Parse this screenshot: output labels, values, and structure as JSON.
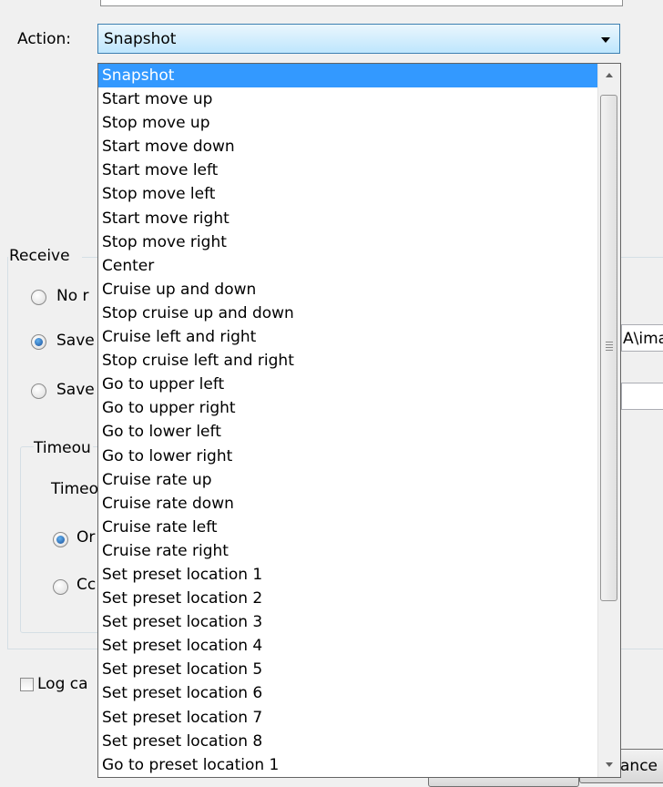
{
  "action": {
    "label": "Action:",
    "selected": "Snapshot"
  },
  "receive": {
    "label": "Receive",
    "options": [
      "No r",
      "Save",
      "Save"
    ],
    "path_fragment": "A\\ima"
  },
  "timeout": {
    "group_label": "Timeou",
    "field_label": "Timeo",
    "options": [
      "Or",
      "Cc"
    ]
  },
  "log": {
    "label": "Log ca"
  },
  "buttons": {
    "cancel_fragment": "ance"
  },
  "dropdown": {
    "options": [
      "Snapshot",
      "Start move up",
      "Stop move up",
      "Start move down",
      "Start move left",
      "Stop move left",
      "Start move right",
      "Stop move right",
      "Center",
      "Cruise up and down",
      "Stop cruise up and down",
      "Cruise left and right",
      "Stop cruise left and right",
      "Go to upper left",
      "Go to upper right",
      "Go to lower left",
      "Go to lower right",
      "Cruise rate up",
      "Cruise rate down",
      "Cruise rate left",
      "Cruise rate right",
      "Set preset location 1",
      "Set preset location 2",
      "Set preset location 3",
      "Set preset location 4",
      "Set preset location 5",
      "Set preset location 6",
      "Set preset location 7",
      "Set preset location 8",
      "Go to preset location 1"
    ]
  },
  "colors": {
    "highlight": "#3399ff",
    "combo_border": "#3c7fb1",
    "window_bg": "#f0f0f0"
  }
}
